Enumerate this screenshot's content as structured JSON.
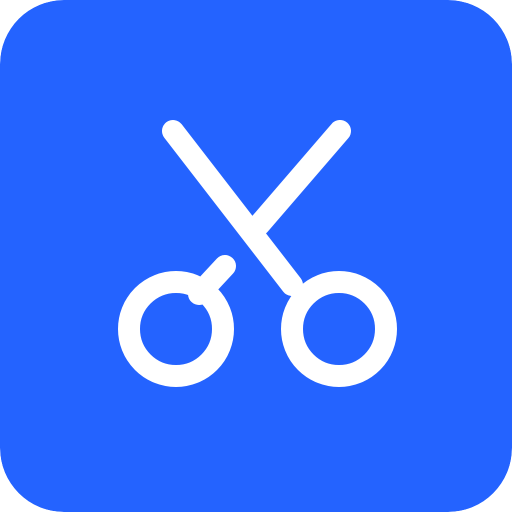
{
  "app_icon": {
    "icon": "scissors-icon",
    "background_color": "#2463ff",
    "glyph_color": "#ffffff"
  }
}
